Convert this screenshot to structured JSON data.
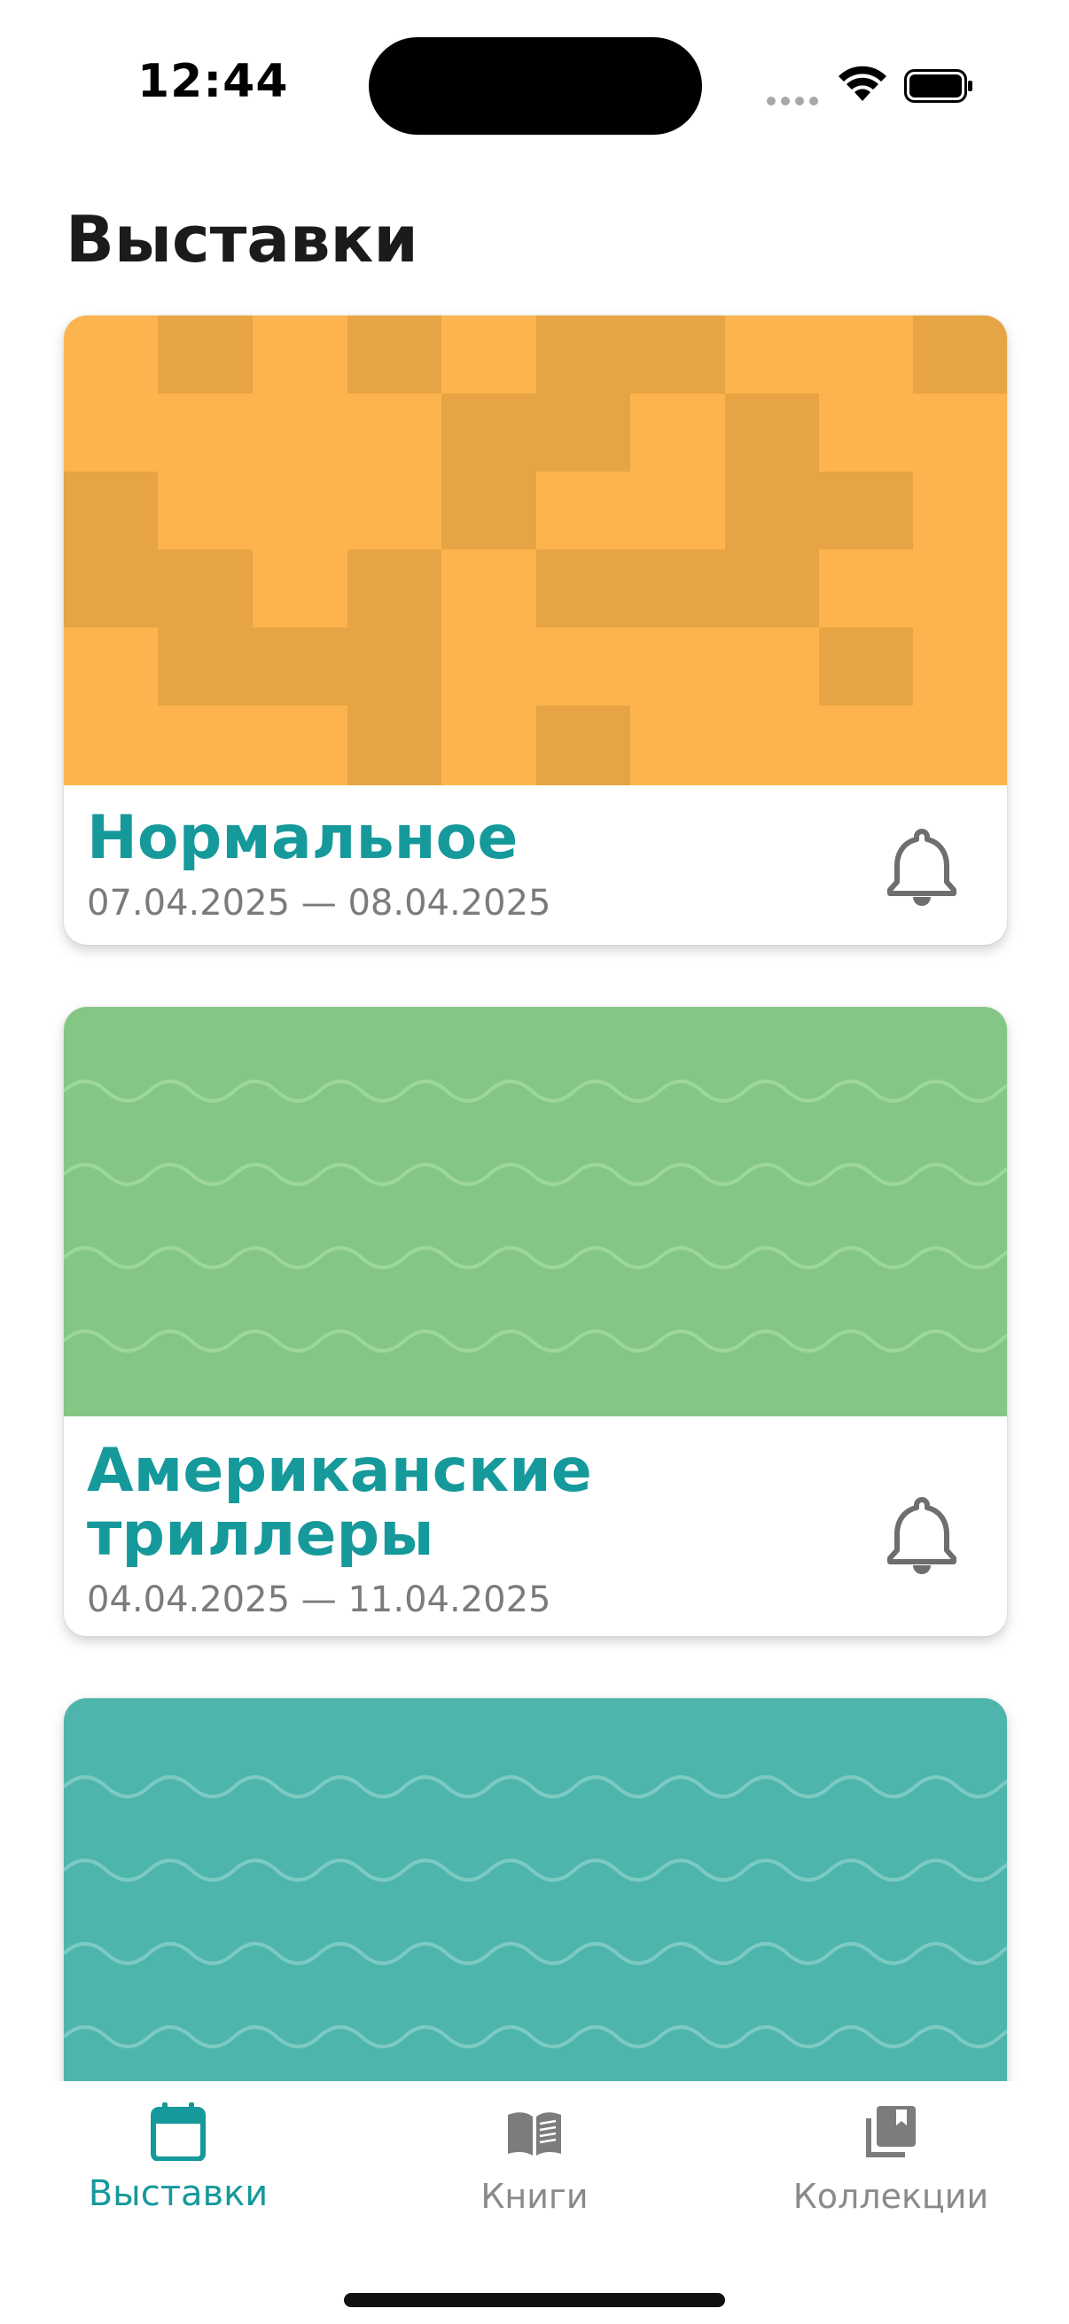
{
  "status_bar": {
    "time": "12:44"
  },
  "page": {
    "title": "Выставки"
  },
  "exhibitions": [
    {
      "title": "Нормальное",
      "dates": "07.04.2025 — 08.04.2025",
      "cover_color": "#FDB44E",
      "cover_pattern": "blocks",
      "bell_icon": "bell-icon"
    },
    {
      "title_line1": "Американские",
      "title_line2": "триллеры",
      "dates": "04.04.2025 — 11.04.2025",
      "cover_color": "#84C784",
      "cover_pattern": "waves",
      "bell_icon": "bell-icon"
    },
    {
      "cover_color": "#4EB5AC",
      "cover_pattern": "waves"
    }
  ],
  "tab_bar": {
    "tabs": [
      {
        "label": "Выставки",
        "icon": "calendar-icon",
        "active": true
      },
      {
        "label": "Книги",
        "icon": "open-book-icon",
        "active": false
      },
      {
        "label": "Коллекции",
        "icon": "library-icon",
        "active": false
      }
    ]
  },
  "colors": {
    "accent": "#16999B",
    "inactive": "#8A8A8A",
    "dates": "#7B7B7B"
  }
}
